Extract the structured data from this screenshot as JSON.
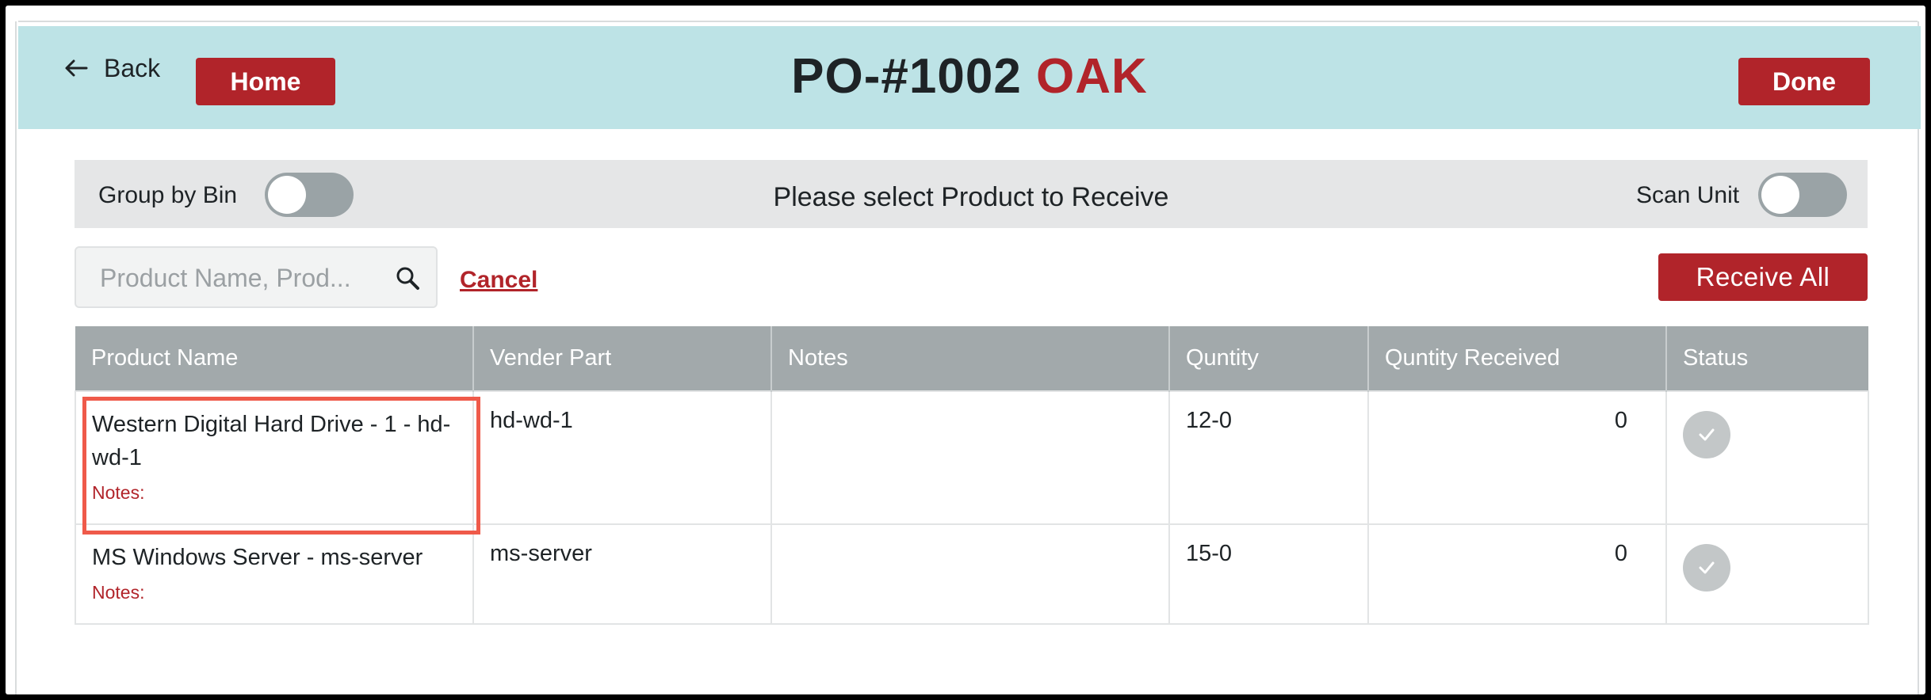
{
  "header": {
    "back_label": "Back",
    "home_label": "Home",
    "title_main": "PO-#1002",
    "title_accent": "OAK",
    "done_label": "Done",
    "background_color": "#bde3e6",
    "accent_color": "#b1242a"
  },
  "toolbar": {
    "group_by_bin_label": "Group by Bin",
    "group_by_bin_on": false,
    "message": "Please select Product to Receive",
    "scan_unit_label": "Scan Unit",
    "scan_unit_on": false
  },
  "search": {
    "placeholder": "Product Name, Prod...",
    "value": "",
    "icon": "search-icon"
  },
  "actions": {
    "cancel_label": "Cancel",
    "receive_all_label": "Receive All"
  },
  "table": {
    "columns": [
      "Product Name",
      "Vender Part",
      "Notes",
      "Quntity",
      "Quntity Received",
      "Status"
    ],
    "rows": [
      {
        "product_name": "Western Digital Hard Drive - 1 - hd-wd-1",
        "notes_label": "Notes:",
        "vender_part": "hd-wd-1",
        "notes": "",
        "quantity": "12-0",
        "quantity_received": "0",
        "status_icon": "check-icon",
        "highlighted": true
      },
      {
        "product_name": "MS Windows Server - ms-server",
        "notes_label": "Notes:",
        "vender_part": "ms-server",
        "notes": "",
        "quantity": "15-0",
        "quantity_received": "0",
        "status_icon": "check-icon",
        "highlighted": false
      }
    ]
  }
}
